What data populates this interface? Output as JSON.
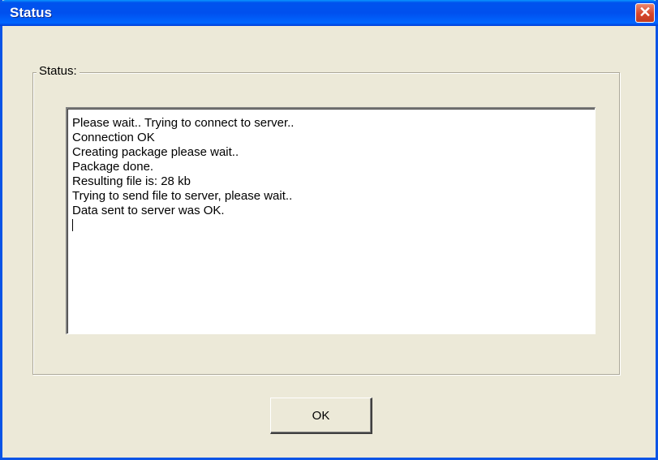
{
  "window": {
    "title": "Status",
    "close_glyph": "✕",
    "titlebar_color": "#0054e3",
    "close_color": "#d7462b",
    "background_color": "#ece9d8"
  },
  "group": {
    "label": "Status:"
  },
  "log": {
    "lines": [
      "Please wait.. Trying to connect to server..",
      "Connection OK",
      "Creating package please wait..",
      "Package done.",
      "Resulting file is: 28 kb",
      "Trying to send file to server, please wait..",
      "Data sent to server was OK."
    ]
  },
  "buttons": {
    "ok_label": "OK"
  },
  "icons": {
    "close": "close-icon"
  }
}
